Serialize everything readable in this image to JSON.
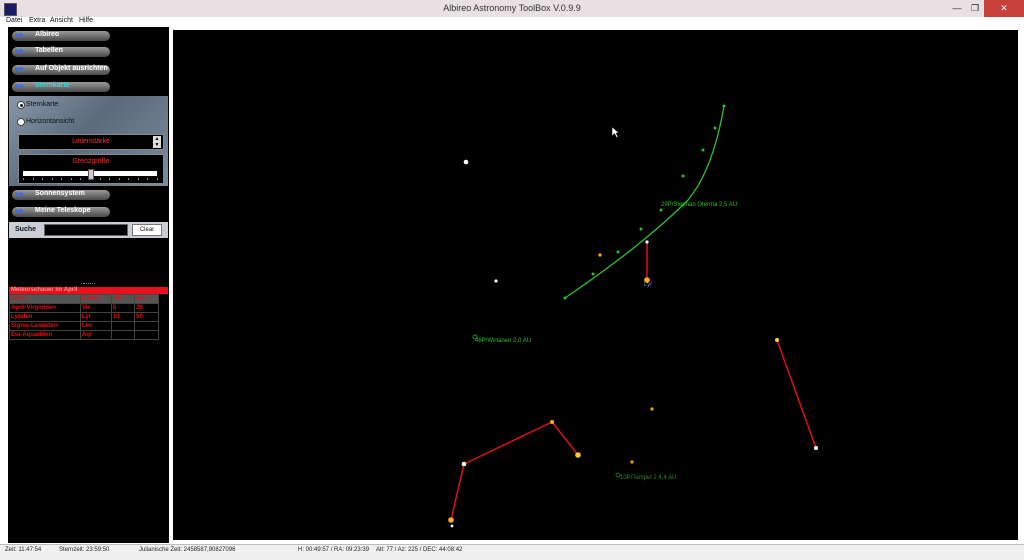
{
  "window": {
    "title": "Albireo Astronomy ToolBox V.0.9.9",
    "btn_min": "—",
    "btn_max": "❐",
    "btn_close": "✕"
  },
  "menu": [
    "Datei",
    "Extra",
    "Ansicht",
    "Hilfe"
  ],
  "sidebar": {
    "headers": [
      {
        "label": "Albireo"
      },
      {
        "label": "Tabellen"
      },
      {
        "label": "Auf Objekt ausrichten"
      },
      {
        "label": "Sternkarte"
      },
      {
        "label": "Sonnensystem"
      },
      {
        "label": "Meine Teleskope"
      }
    ],
    "arrows": "▶▶",
    "star_chart": {
      "radio_1": "Sternkarte",
      "radio_2": "Horizontansicht",
      "line_width_label": "Linienstärke",
      "limit_label": "Grenzgröße",
      "spin_up": "▲",
      "spin_down": "▼",
      "limit_value": 0.5
    },
    "search": {
      "label": "Suche",
      "clear_label": "Clear",
      "value": ""
    },
    "meteor": {
      "title": "Meteorschauer im April",
      "columns": [
        "Strom",
        "Datum",
        "Hfl/h",
        "km/s"
      ],
      "rows": [
        [
          "April-Virginiden",
          "Vir",
          "5",
          "26"
        ],
        [
          "Lyriden",
          "Lyr",
          "15",
          "50"
        ],
        [
          "Sigma-Leoniden",
          "Leo",
          "",
          ""
        ],
        [
          "Eta-Aquariden",
          "Aqr",
          "",
          ""
        ]
      ]
    }
  },
  "sky": {
    "labels": {
      "comet_1": "29P/Stephan Oterma 2,5 AU",
      "comet_2": "46P/Wirtanen 2,0 AU",
      "comet_3": "10P/Tempel 2 4,4 AU",
      "lyr": "Lyr"
    },
    "colors": {
      "comet": "#2dbf2d",
      "line": "#e01010",
      "star_white": "#ffffff",
      "star_yellow": "#ffcc33",
      "star_orange": "#ff9a1a"
    }
  },
  "status": {
    "time": "Zeit: 11:47:54",
    "sidereal": "Sternzeit: 23:59:50",
    "julian": "Julianische Zeit: 2458587,90827096",
    "ha": "H: 00:49:57 / RA: 09:23:39",
    "altaz": "Alt: 77 / Az: 225 / DEC: 44:08:42"
  }
}
